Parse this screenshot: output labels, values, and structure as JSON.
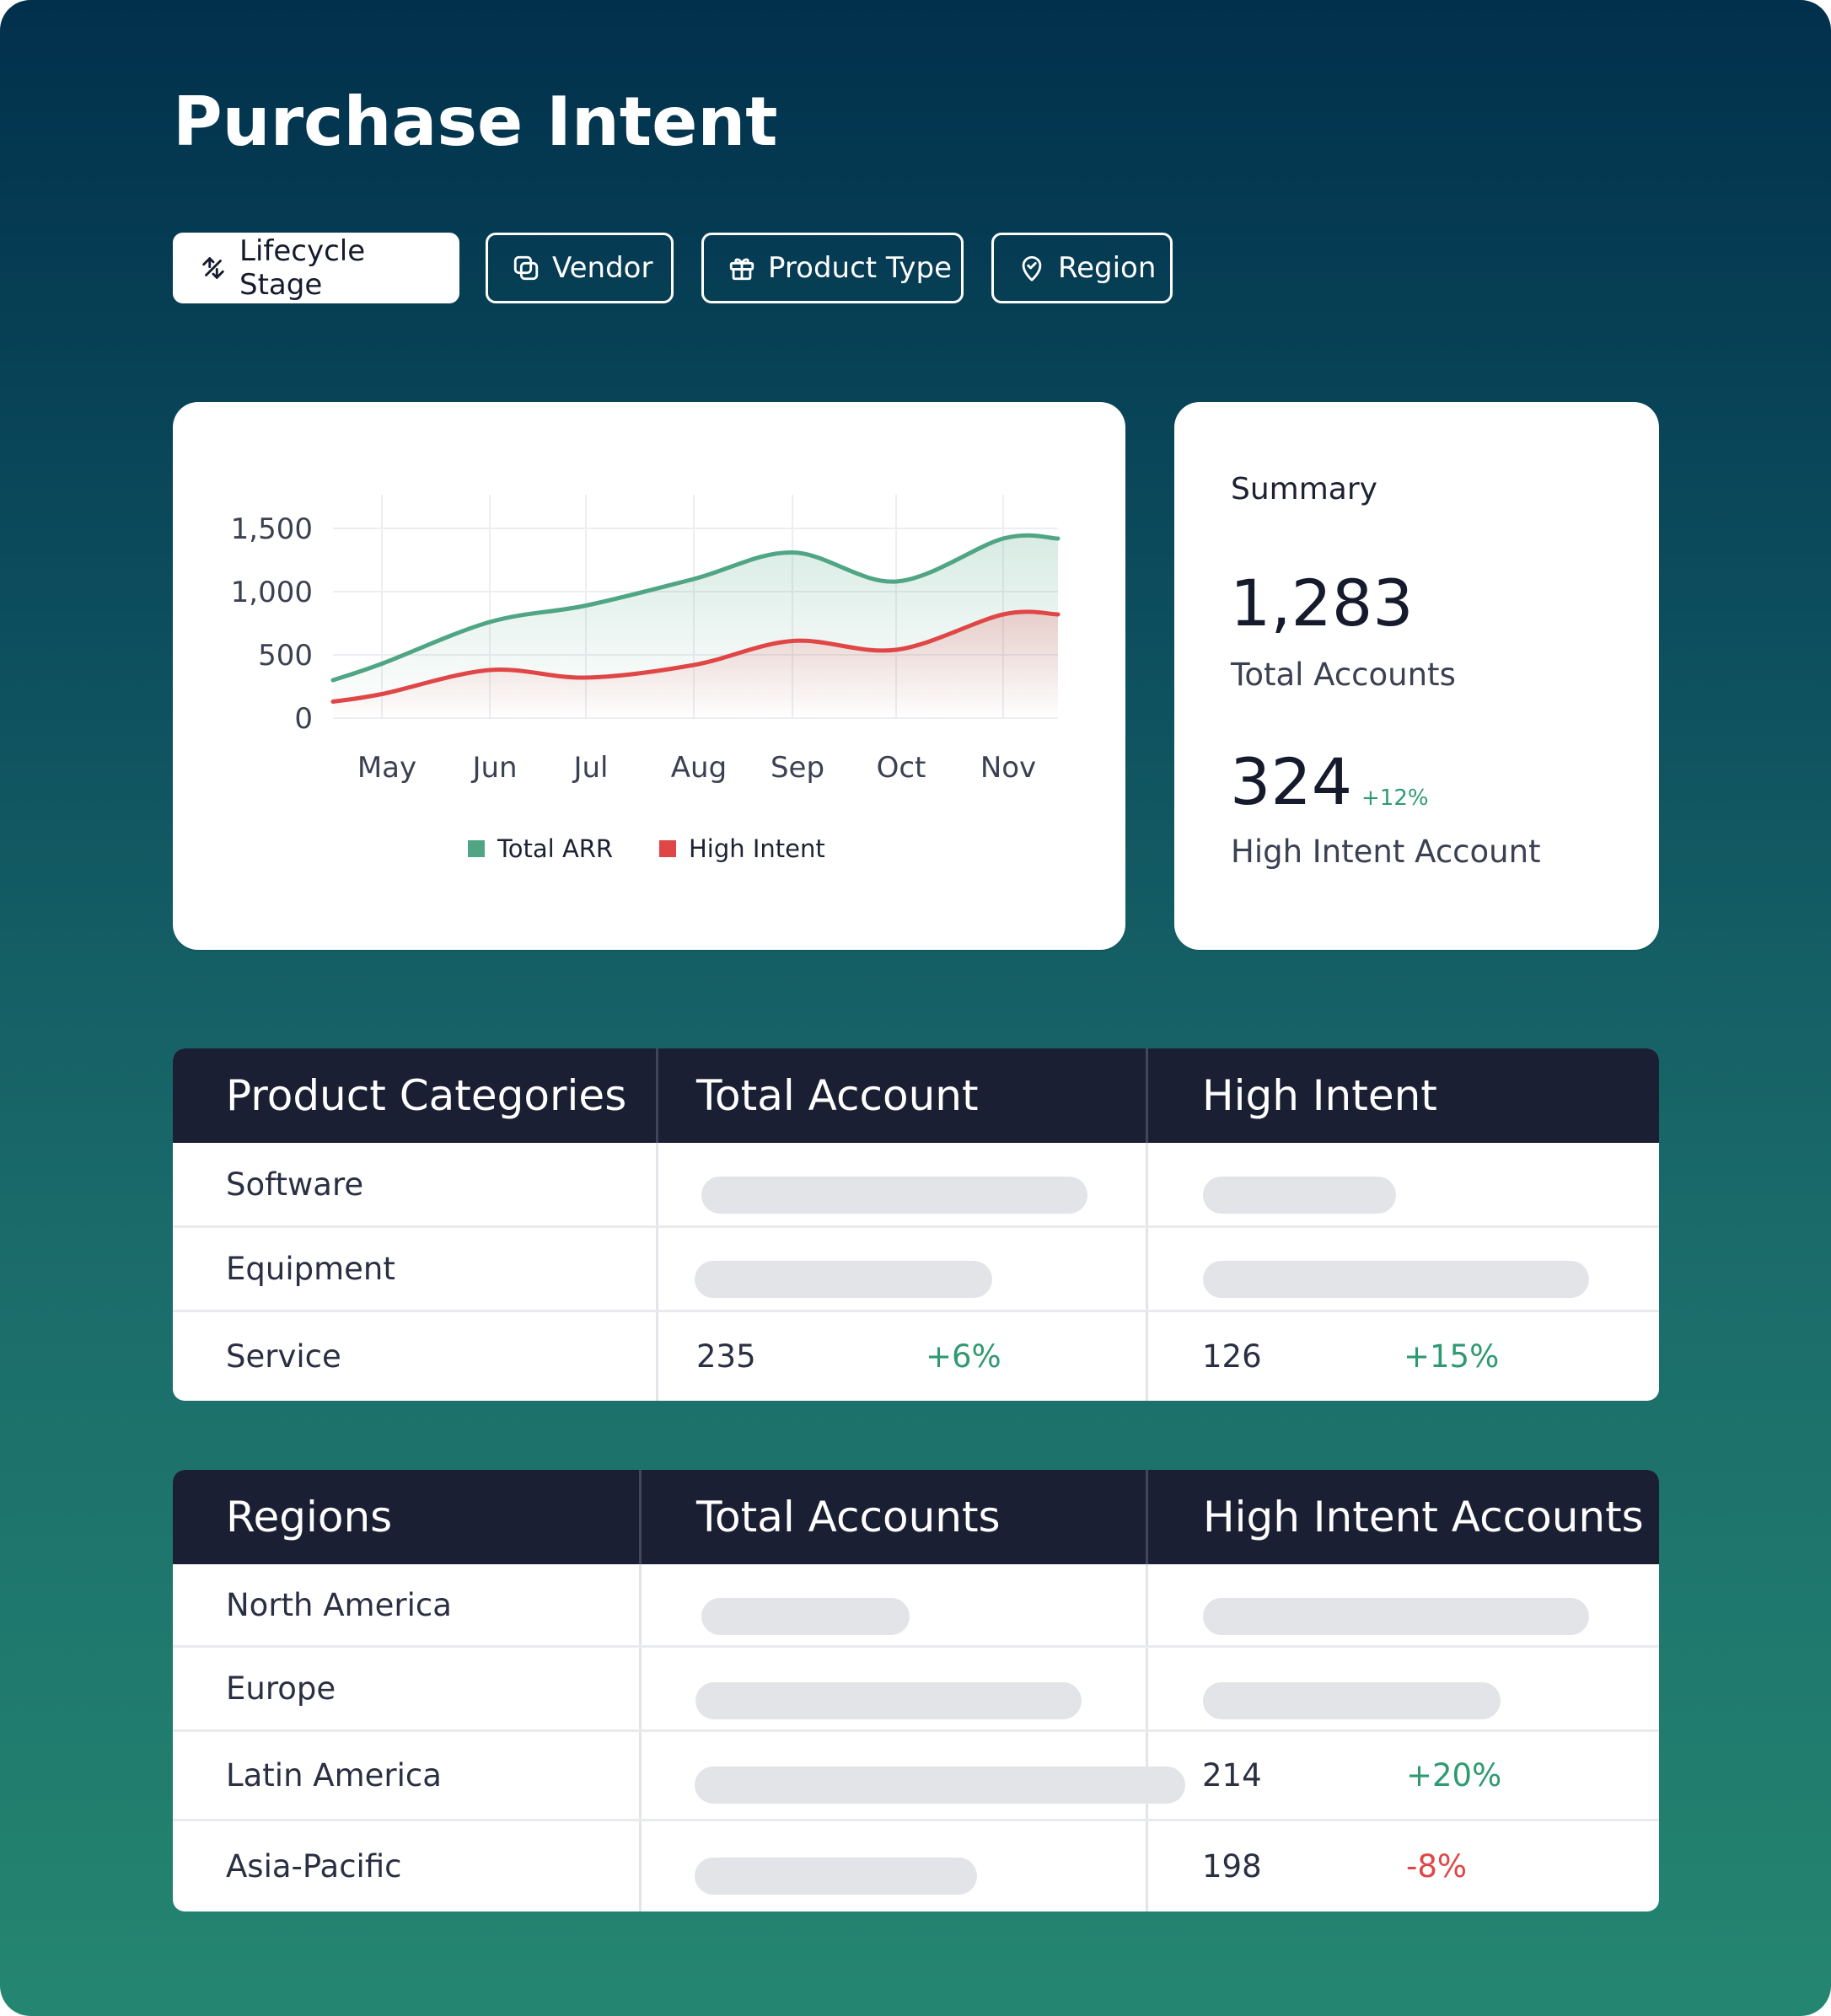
{
  "page": {
    "title": "Purchase Intent"
  },
  "filters": [
    {
      "label": "Lifecycle Stage",
      "icon": "lifecycle-arrows-icon",
      "active": true
    },
    {
      "label": "Vendor",
      "icon": "vendor-stack-icon",
      "active": false
    },
    {
      "label": "Product Type",
      "icon": "gift-box-icon",
      "active": false
    },
    {
      "label": "Region",
      "icon": "location-check-icon",
      "active": false
    }
  ],
  "chart_data": {
    "type": "area",
    "categories": [
      "May",
      "Jun",
      "Jul",
      "Aug",
      "Sep",
      "Oct",
      "Nov"
    ],
    "y_ticks": [
      "0",
      "500",
      "1,000",
      "1,500"
    ],
    "ylim": [
      0,
      1600
    ],
    "legend_position": "bottom",
    "grid": true,
    "series": [
      {
        "name": "Total ARR",
        "color": "#4fa584",
        "values": [
          430,
          760,
          890,
          1100,
          1310,
          1080,
          1420
        ]
      },
      {
        "name": "High Intent",
        "color": "#e04646",
        "values": [
          190,
          380,
          320,
          420,
          610,
          540,
          820
        ]
      }
    ]
  },
  "summary": {
    "label": "Summary",
    "total_value": "1,283",
    "total_label": "Total Accounts",
    "high_value": "324",
    "high_delta": "+12%",
    "high_label": "High Intent Account"
  },
  "products_table": {
    "headers": [
      "Product Categories",
      "Total Account",
      "High Intent"
    ],
    "rows": [
      {
        "name": "Software",
        "total": null,
        "total_bar": 0.26,
        "high": null,
        "high_bar": 0.13
      },
      {
        "name": "Equipment",
        "total": null,
        "total_bar": 0.2,
        "high": null,
        "high_bar": 0.26
      },
      {
        "name": "Service",
        "total": "235",
        "total_delta": "+6%",
        "high": "126",
        "high_delta": "+15%"
      }
    ]
  },
  "regions_table": {
    "headers": [
      "Regions",
      "Total Accounts",
      "High Intent Accounts"
    ],
    "rows": [
      {
        "name": "North America",
        "total": null,
        "total_bar": 0.14,
        "high": null,
        "high_bar": 0.26
      },
      {
        "name": "Europe",
        "total": null,
        "total_bar": 0.26,
        "high": null,
        "high_bar": 0.2
      },
      {
        "name": "Latin America",
        "total": null,
        "total_bar": 0.33,
        "high": "214",
        "high_delta": "+20%"
      },
      {
        "name": "Asia-Pacific",
        "total": null,
        "total_bar": 0.19,
        "high": "198",
        "high_delta": "-8%"
      }
    ]
  },
  "colors": {
    "positive": "#2f9a72",
    "negative": "#e04646",
    "header_bg": "#1a1f33"
  }
}
